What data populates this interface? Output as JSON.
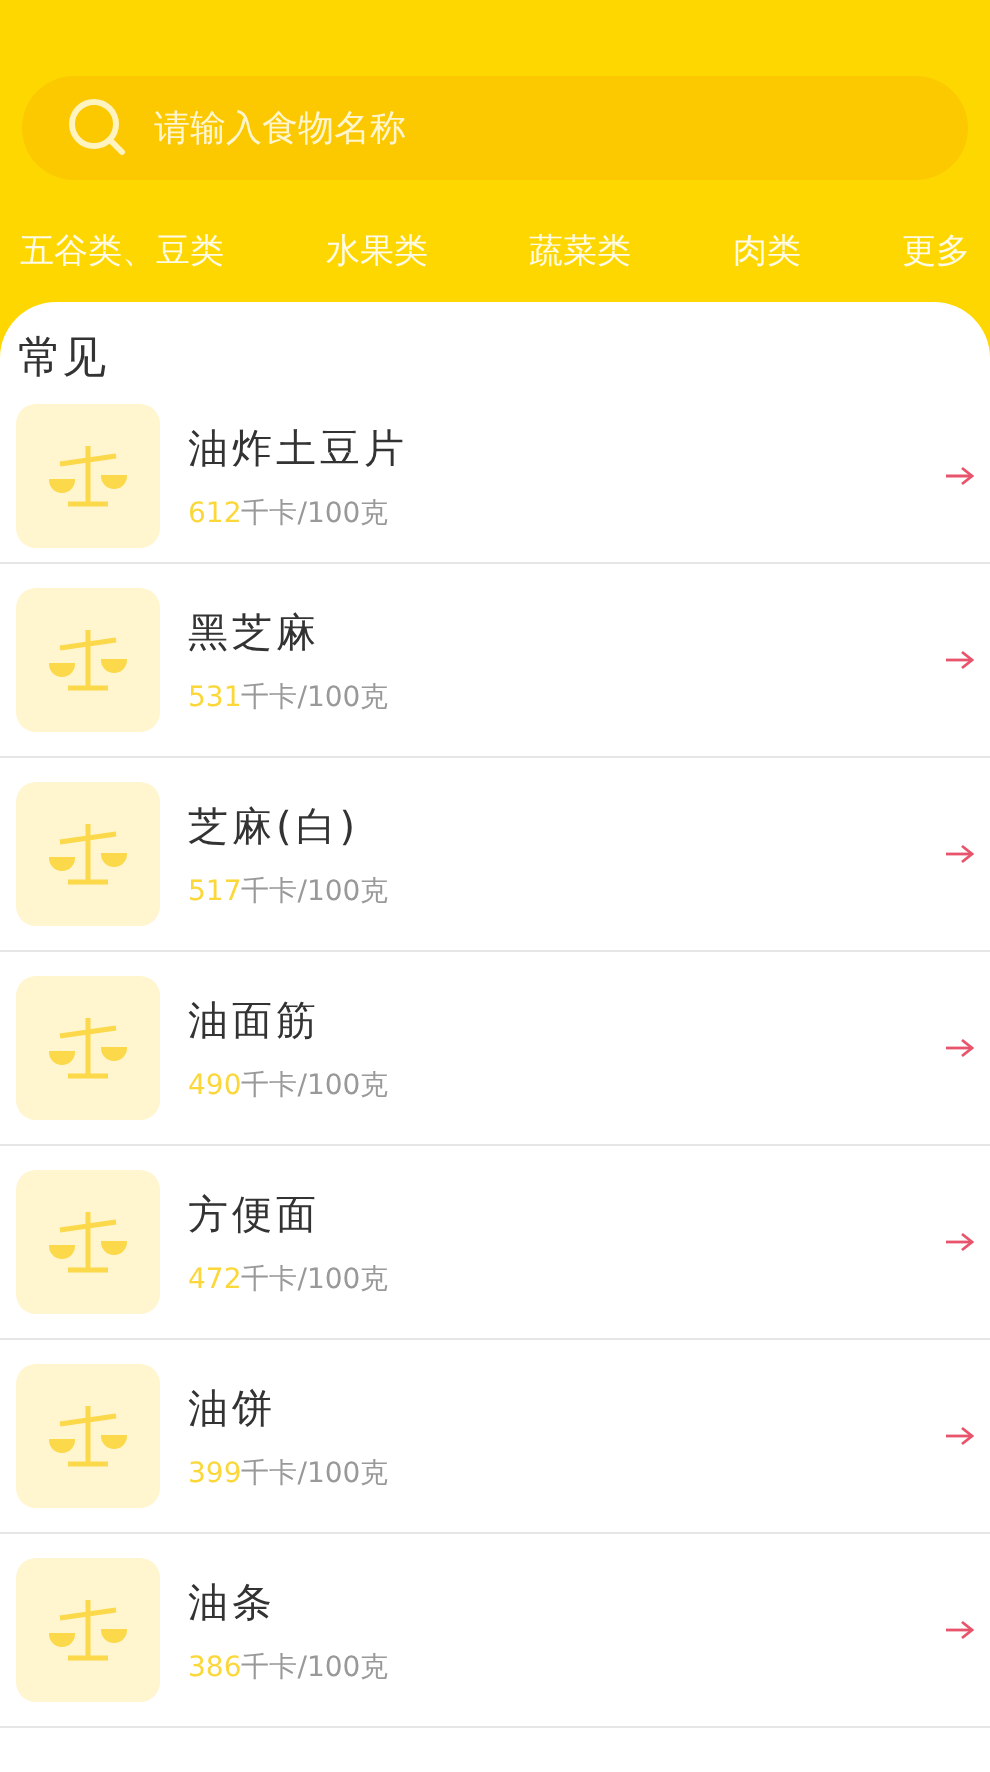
{
  "search": {
    "placeholder": "请输入食物名称"
  },
  "categories": [
    {
      "label": "五谷类、豆类"
    },
    {
      "label": "水果类"
    },
    {
      "label": "蔬菜类"
    },
    {
      "label": "肉类"
    },
    {
      "label": "更多"
    }
  ],
  "section": {
    "title": "常见"
  },
  "foods": [
    {
      "name": "油炸土豆片",
      "kcal": "612",
      "unit": "千卡/100克"
    },
    {
      "name": "黑芝麻",
      "kcal": "531",
      "unit": "千卡/100克"
    },
    {
      "name": "芝麻(白)",
      "kcal": "517",
      "unit": "千卡/100克"
    },
    {
      "name": "油面筋",
      "kcal": "490",
      "unit": "千卡/100克"
    },
    {
      "name": "方便面",
      "kcal": "472",
      "unit": "千卡/100克"
    },
    {
      "name": "油饼",
      "kcal": "399",
      "unit": "千卡/100克"
    },
    {
      "name": "油条",
      "kcal": "386",
      "unit": "千卡/100克"
    }
  ]
}
